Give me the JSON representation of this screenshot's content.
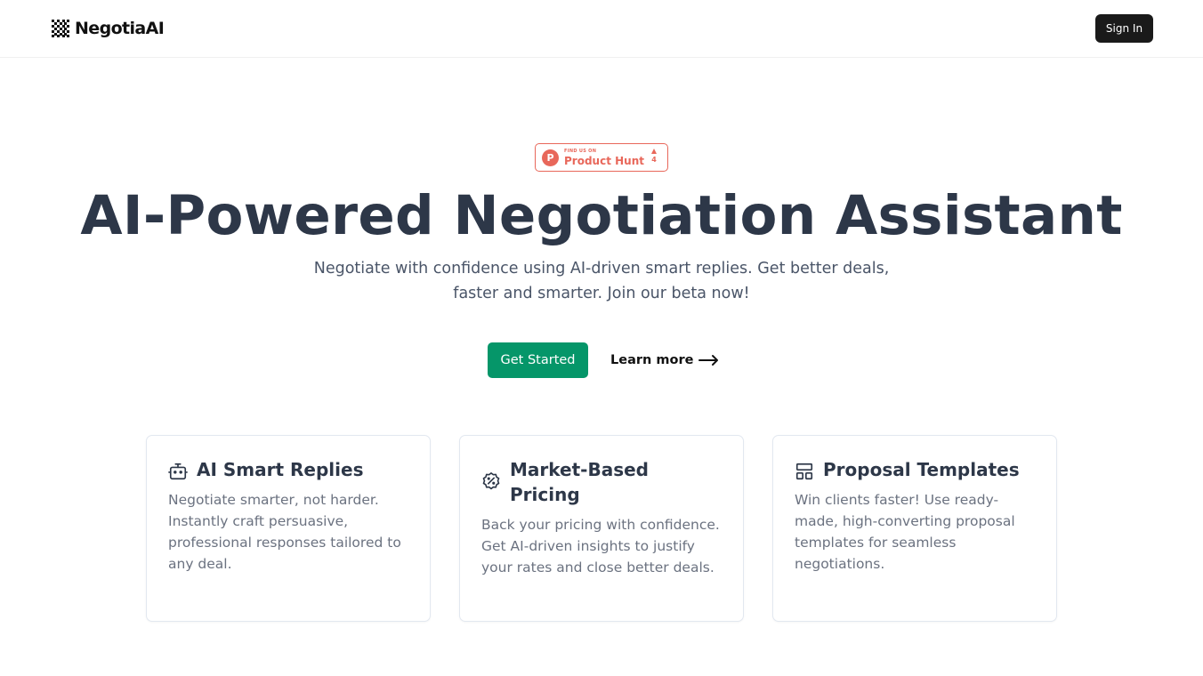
{
  "header": {
    "brand": "NegotiaAI",
    "sign_in": "Sign In"
  },
  "badge": {
    "small_text": "FIND US ON",
    "big_text": "Product Hunt",
    "logo_letter": "P",
    "count": "4",
    "color": "#e8675a"
  },
  "hero": {
    "title": "AI-Powered Negotiation Assistant",
    "subtitle": "Negotiate with confidence using AI-driven smart replies. Get better deals, faster and smarter. Join our beta now!",
    "primary_cta": "Get Started",
    "secondary_cta": "Learn more",
    "accent_color": "#059669"
  },
  "features": [
    {
      "icon": "robot-icon",
      "title": "AI Smart Replies",
      "description": "Negotiate smarter, not harder. Instantly craft persuasive, professional responses tailored to any deal."
    },
    {
      "icon": "percent-badge-icon",
      "title": "Market-Based Pricing",
      "description": "Back your pricing with confidence. Get AI-driven insights to justify your rates and close better deals."
    },
    {
      "icon": "template-layout-icon",
      "title": "Proposal Templates",
      "description": "Win clients faster! Use ready-made, high-converting proposal templates for seamless negotiations."
    }
  ]
}
